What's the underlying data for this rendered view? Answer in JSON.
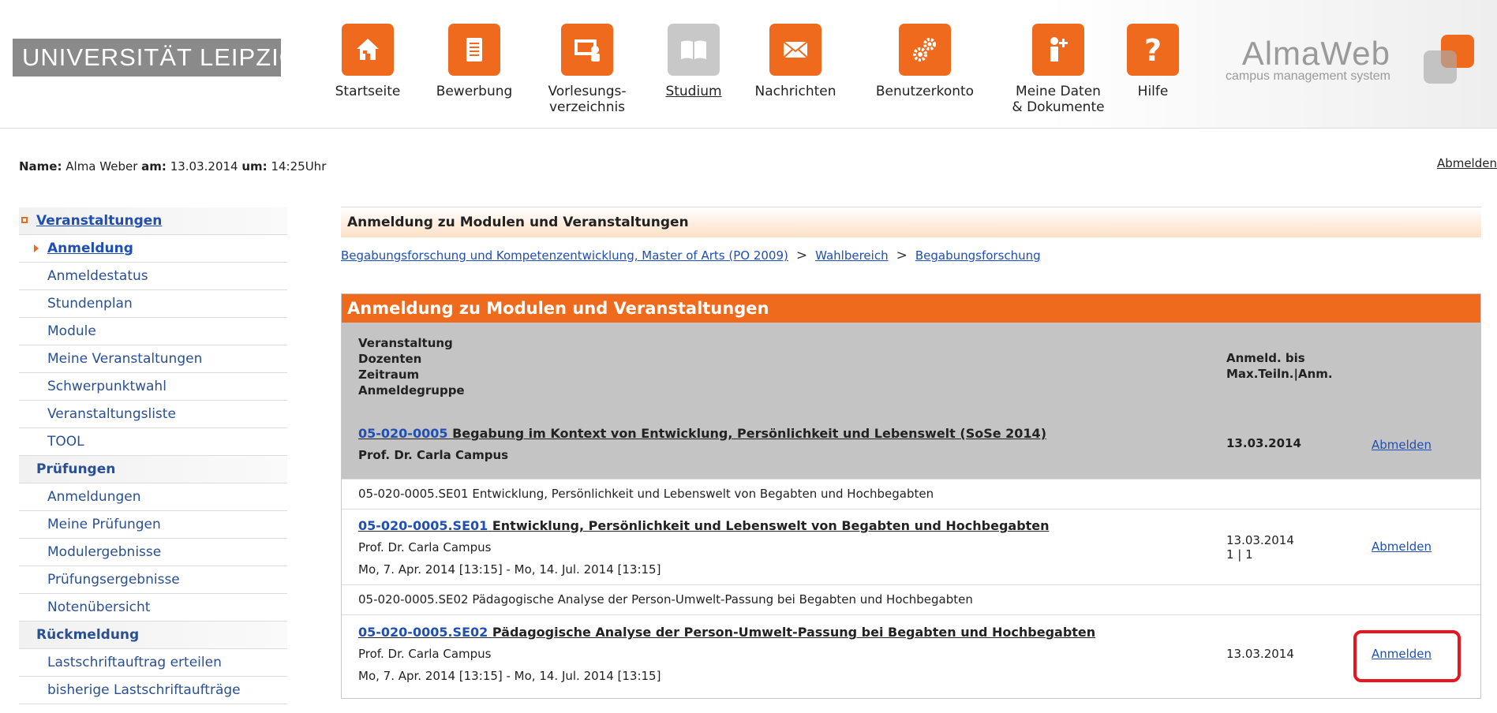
{
  "header": {
    "university_logo": "UNIVERSITÄT LEIPZIG",
    "nav": [
      {
        "label": "Startseite",
        "icon": "home-icon"
      },
      {
        "label": "Bewerbung",
        "icon": "document-icon"
      },
      {
        "label": "Vorlesungs-",
        "label2": "verzeichnis",
        "icon": "presentation-icon"
      },
      {
        "label": "Studium",
        "icon": "book-icon",
        "active": true
      },
      {
        "label": "Nachrichten",
        "icon": "envelope-icon"
      },
      {
        "label": "Benutzerkonto",
        "icon": "gears-icon"
      },
      {
        "label": "Meine Daten",
        "label2": "& Dokumente",
        "icon": "user-add-icon"
      },
      {
        "label": "Hilfe",
        "icon": "question-icon"
      }
    ],
    "brand": {
      "title": "AlmaWeb",
      "subtitle": "campus management system"
    },
    "accent_color": "#f06a1e"
  },
  "userbar": {
    "name_label": "Name:",
    "name": "Alma Weber",
    "date_label": "am:",
    "date": "13.03.2014",
    "time_label": "um:",
    "time": "14:25",
    "time_suffix": "Uhr",
    "logout": "Abmelden"
  },
  "sidebar": {
    "sections": [
      {
        "title": "Veranstaltungen",
        "items": [
          "Anmeldung",
          "Anmeldestatus",
          "Stundenplan",
          "Module",
          "Meine Veranstaltungen",
          "Schwerpunktwahl",
          "Veranstaltungsliste",
          "TOOL"
        ]
      },
      {
        "title": "Prüfungen",
        "items": [
          "Anmeldungen",
          "Meine Prüfungen",
          "Modulergebnisse",
          "Prüfungsergebnisse",
          "Notenübersicht"
        ]
      },
      {
        "title": "Rückmeldung",
        "items": [
          "Lastschriftauftrag erteilen",
          "bisherige Lastschriftaufträge"
        ]
      }
    ]
  },
  "main": {
    "page_title": "Anmeldung zu Modulen und Veranstaltungen",
    "breadcrumb": [
      "Begabungsforschung und Kompetenzentwicklung, Master of Arts (PO 2009)",
      "Wahlbereich",
      "Begabungsforschung"
    ],
    "table": {
      "title": "Anmeldung zu Modulen und Veranstaltungen",
      "header_left": [
        "Veranstaltung",
        "Dozenten",
        "Zeitraum",
        "Anmeldegruppe"
      ],
      "header_right": [
        "Anmeld. bis",
        "Max.Teiln.|Anm."
      ],
      "module": {
        "code": "05-020-0005",
        "title": "Begabung im Kontext von Entwicklung, Persönlichkeit und Lebenswelt (SoSe 2014)",
        "lecturer": "Prof. Dr. Carla Campus",
        "deadline": "13.03.2014",
        "action": "Abmelden"
      },
      "subgroup1": "05-020-0005.SE01 Entwicklung, Persönlichkeit und Lebenswelt von Begabten und Hochbegabten",
      "entry1": {
        "code": "05-020-0005.SE01",
        "title": "Entwicklung, Persönlichkeit und Lebenswelt von Begabten und Hochbegabten",
        "lecturer": "Prof. Dr. Carla Campus",
        "period": "Mo, 7. Apr. 2014 [13:15] - Mo, 14. Jul. 2014 [13:15]",
        "deadline": "13.03.2014",
        "capacity": "1 | 1",
        "action": "Abmelden"
      },
      "subgroup2": "05-020-0005.SE02 Pädagogische Analyse der Person-Umwelt-Passung bei Begabten und Hochbegabten",
      "entry2": {
        "code": "05-020-0005.SE02",
        "title": "Pädagogische Analyse der Person-Umwelt-Passung bei Begabten und Hochbegabten",
        "lecturer": "Prof. Dr. Carla Campus",
        "period": "Mo, 7. Apr. 2014 [13:15] - Mo, 14. Jul. 2014 [13:15]",
        "deadline": "13.03.2014",
        "action": "Anmelden"
      }
    }
  }
}
